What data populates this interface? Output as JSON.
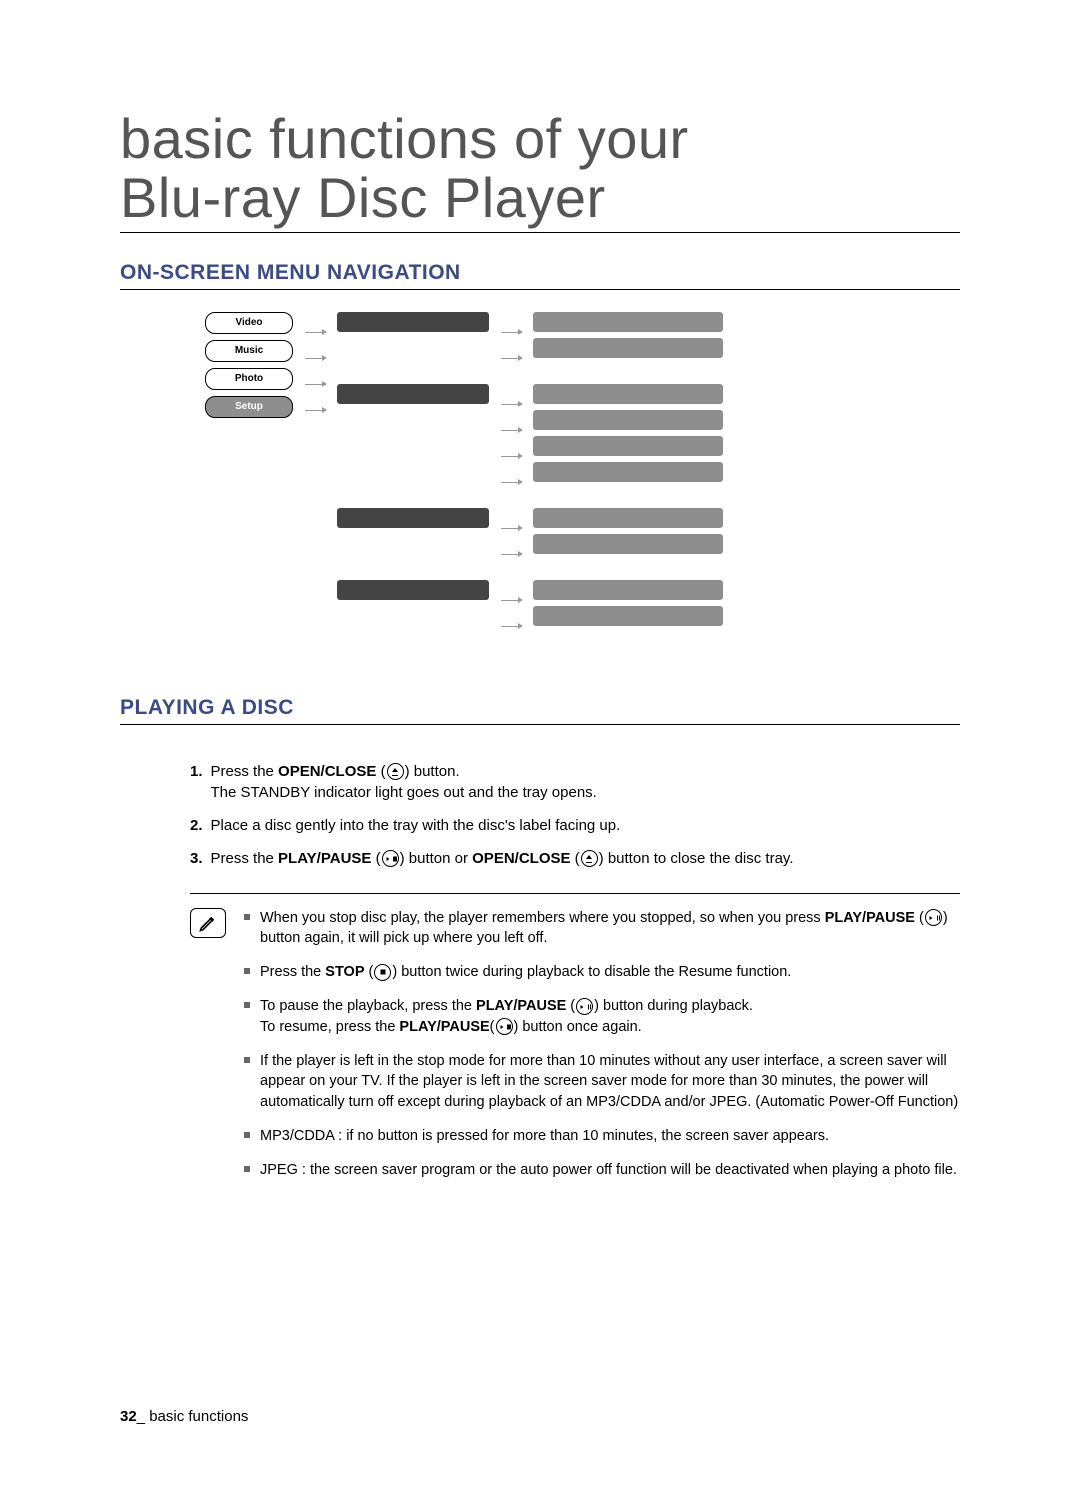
{
  "title_line1": "basic functions of your",
  "title_line2": "Blu-ray Disc Player",
  "section1_heading": "ON-SCREEN MENU NAVIGATION",
  "menu_items": [
    "Video",
    "Music",
    "Photo",
    "Setup"
  ],
  "diagram_groups": [
    {
      "right_bars": 2
    },
    {
      "right_bars": 4
    },
    {
      "right_bars": 2
    },
    {
      "right_bars": 2
    }
  ],
  "section2_heading": "PLAYING A DISC",
  "steps": [
    {
      "num": "1.",
      "parts": [
        {
          "t": "Press the "
        },
        {
          "t": "OPEN/CLOSE",
          "b": true
        },
        {
          "t": " ("
        },
        {
          "icon": "eject"
        },
        {
          "t": ") button."
        },
        {
          "br": true
        },
        {
          "t": "The STANDBY indicator light goes out and the tray opens."
        }
      ]
    },
    {
      "num": "2.",
      "parts": [
        {
          "t": "Place a disc gently into the tray with the disc's label facing up."
        }
      ]
    },
    {
      "num": "3.",
      "parts": [
        {
          "t": "Press the "
        },
        {
          "t": "PLAY/PAUSE",
          "b": true
        },
        {
          "t": " ("
        },
        {
          "icon": "playpause"
        },
        {
          "t": ") button or "
        },
        {
          "t": "OPEN/CLOSE",
          "b": true
        },
        {
          "t": " ("
        },
        {
          "icon": "eject"
        },
        {
          "t": ") button to close the disc tray."
        }
      ]
    }
  ],
  "notes": [
    {
      "parts": [
        {
          "t": "When you stop disc play, the player remembers where you stopped, so when you press "
        },
        {
          "t": "PLAY/PAUSE",
          "b": true
        },
        {
          "t": " ("
        },
        {
          "icon": "playpause"
        },
        {
          "t": ") button again, it will pick up where you left off."
        }
      ]
    },
    {
      "parts": [
        {
          "t": "Press the "
        },
        {
          "t": "STOP",
          "b": true
        },
        {
          "t": " ("
        },
        {
          "icon": "stop"
        },
        {
          "t": ") button twice during playback to disable the Resume function."
        }
      ]
    },
    {
      "parts": [
        {
          "t": "To pause the playback, press the "
        },
        {
          "t": "PLAY/PAUSE",
          "b": true
        },
        {
          "t": " ("
        },
        {
          "icon": "playpause"
        },
        {
          "t": ") button during playback."
        },
        {
          "br": true
        },
        {
          "t": "To resume, press the "
        },
        {
          "t": "PLAY/PAUSE",
          "b": true
        },
        {
          "t": "("
        },
        {
          "icon": "playpause"
        },
        {
          "t": ") button once again."
        }
      ]
    },
    {
      "parts": [
        {
          "t": "If the player is left in the stop mode for more than 10 minutes without any user interface, a screen saver will appear on your TV. If the player is left in the screen saver mode for more than 30 minutes, the power will automatically turn off except during playback of an MP3/CDDA and/or JPEG. (Automatic Power-Off Function)"
        }
      ]
    },
    {
      "parts": [
        {
          "t": "MP3/CDDA : if no button is pressed for more than 10 minutes, the screen saver appears."
        }
      ]
    },
    {
      "parts": [
        {
          "t": "JPEG : the screen saver program or the auto power off function will be deactivated when playing a photo file."
        }
      ]
    }
  ],
  "footer_page": "32",
  "footer_text": "_ basic functions"
}
